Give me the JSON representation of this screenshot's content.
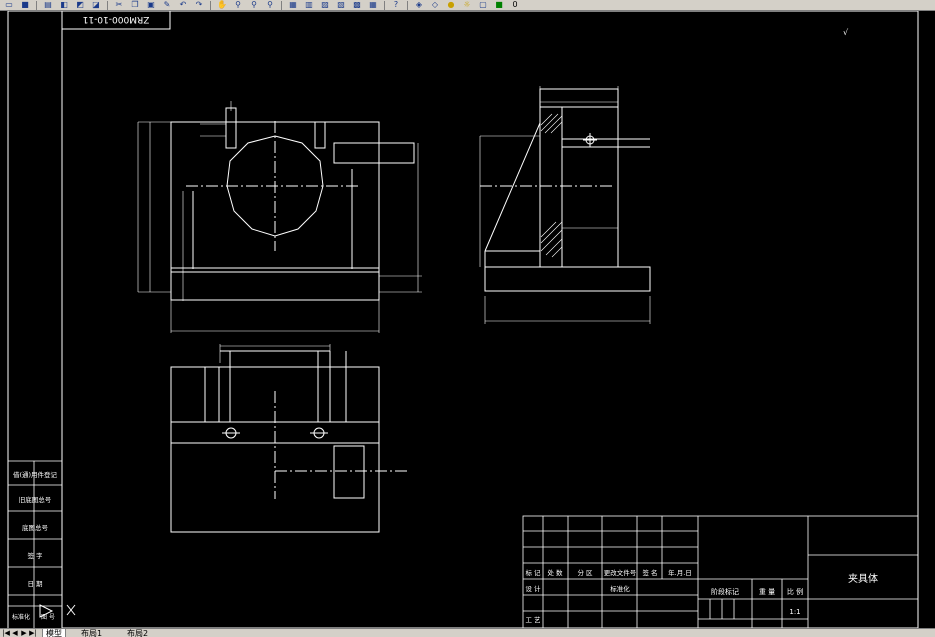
{
  "toolbar": {
    "icons": [
      "open-icon",
      "save-icon",
      "print-icon",
      "preview-icon",
      "publish-icon",
      "cut-icon",
      "copy-icon",
      "paste-icon",
      "match-icon",
      "undo-icon",
      "redo-icon",
      "pan-icon",
      "zoom-realtime-icon",
      "zoom-window-icon",
      "zoom-previous-icon",
      "properties-icon",
      "designcenter-icon",
      "toolpalette-icon",
      "sheetset-icon",
      "markup-icon",
      "calculator-icon",
      "help-icon",
      "layer-icon",
      "layer-state-icon",
      "bulb-icon",
      "sun-icon",
      "lock-icon",
      "color-swatch-icon"
    ],
    "layer_name": "0"
  },
  "drawing": {
    "title_code": "ZRM000-10-11",
    "corner_note": "√",
    "scale": "1:1",
    "part_name": "夹具体",
    "side_labels": [
      "借(通)用件登记",
      "旧底图总号",
      "底图总号",
      "签 字",
      "日 期",
      "标准化",
      "图 号"
    ],
    "title_block": {
      "header_row": [
        "标 记",
        "处 数",
        "分 区",
        "更改文件号",
        "签 名",
        "年.月.日"
      ],
      "row_design": "设 计",
      "row_standard": "标准化",
      "row_process": "工 艺",
      "stage_mark": "阶段标记",
      "weight": "重 量",
      "ratio": "比 例"
    }
  },
  "tabs": {
    "model": "模型",
    "layout1": "布局1",
    "layout2": "布局2"
  },
  "colors": {
    "line": "#ffffff",
    "background": "#000000",
    "ui": "#d4d0c8"
  }
}
